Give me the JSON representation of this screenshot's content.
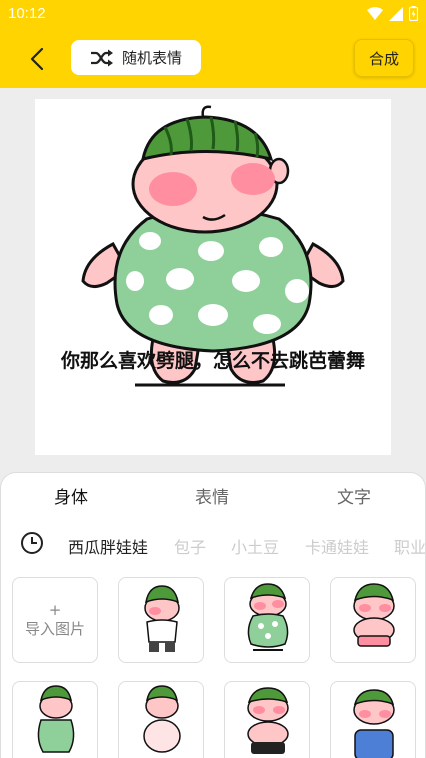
{
  "status_bar": {
    "time": "10:12"
  },
  "header": {
    "random_label": "随机表情",
    "compose_label": "合成"
  },
  "canvas": {
    "caption": "你那么喜欢劈腿，怎么不去跳芭蕾舞"
  },
  "panel": {
    "tabs": [
      {
        "label": "身体",
        "active": true
      },
      {
        "label": "表情",
        "active": false
      },
      {
        "label": "文字",
        "active": false
      }
    ],
    "categories": [
      {
        "label": "西瓜胖娃娃",
        "active": true
      },
      {
        "label": "包子",
        "active": false
      },
      {
        "label": "小土豆",
        "active": false
      },
      {
        "label": "卡通娃娃",
        "active": false
      },
      {
        "label": "职业",
        "active": false
      }
    ],
    "import_plus": "+",
    "import_label": "导入图片"
  },
  "colors": {
    "accent": "#ffd400",
    "dress": "#8fcf9a",
    "skin": "#ffc6c8",
    "blush": "#ff8fa0",
    "watermelon": "#4e9a3a"
  }
}
